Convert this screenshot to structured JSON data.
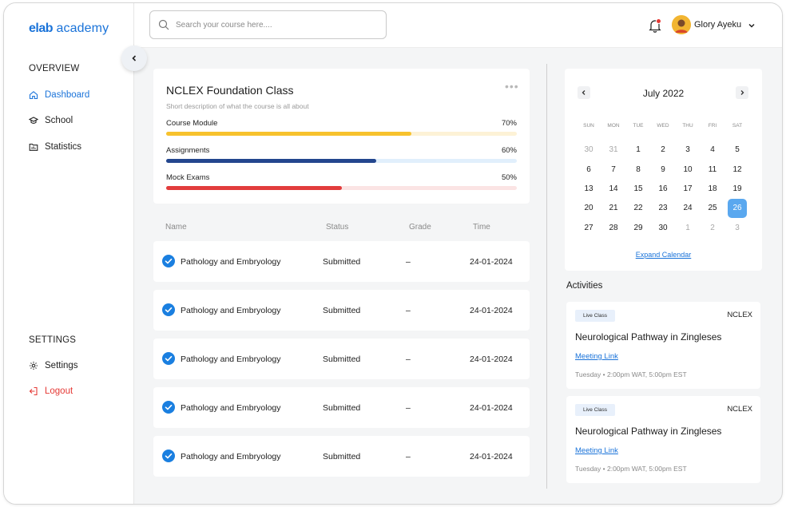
{
  "brand": {
    "logo_mark": "elab",
    "logo_text": " academy",
    "accent": "#1a73d9"
  },
  "sidebar": {
    "overview_title": "OVERVIEW",
    "items": [
      {
        "label": "Dashboard",
        "icon": "home-icon",
        "active": true
      },
      {
        "label": "School",
        "icon": "graduation-cap-icon"
      },
      {
        "label": "Statistics",
        "icon": "folder-chart-icon"
      }
    ],
    "settings_title": "SETTINGS",
    "settings_items": [
      {
        "label": "Settings",
        "icon": "gear-icon"
      },
      {
        "label": "Logout",
        "icon": "logout-icon",
        "color": "#e53935"
      }
    ]
  },
  "header": {
    "search_placeholder": "Search your course here....",
    "user_name": "Glory Ayeku",
    "notification_dot_color": "#e53935"
  },
  "course": {
    "title": "NCLEX Foundation Class",
    "description": "Short description of what the course is all about",
    "progress": [
      {
        "label": "Course Module",
        "percent_label": "70%",
        "value": 0.7,
        "color": "#f7c22d",
        "track": "#fdf2d6"
      },
      {
        "label": "Assignments",
        "percent_label": "60%",
        "value": 0.6,
        "color": "#23468e",
        "track": "#e1effc"
      },
      {
        "label": "Mock Exams",
        "percent_label": "50%",
        "value": 0.5,
        "color": "#e23c3c",
        "track": "#fbe4e4"
      }
    ]
  },
  "table": {
    "headers": {
      "name": "Name",
      "status": "Status",
      "grade": "Grade",
      "time": "Time"
    },
    "rows": [
      {
        "name": "Pathology and Embryology",
        "status": "Submitted",
        "grade": "–",
        "time": "24-01-2024"
      },
      {
        "name": "Pathology and Embryology",
        "status": "Submitted",
        "grade": "–",
        "time": "24-01-2024"
      },
      {
        "name": "Pathology and Embryology",
        "status": "Submitted",
        "grade": "–",
        "time": "24-01-2024"
      },
      {
        "name": "Pathology and Embryology",
        "status": "Submitted",
        "grade": "–",
        "time": "24-01-2024"
      },
      {
        "name": "Pathology and Embryology",
        "status": "Submitted",
        "grade": "–",
        "time": "24-01-2024"
      }
    ]
  },
  "calendar": {
    "month": "July 2022",
    "weekdays": [
      "SUN",
      "MON",
      "TUE",
      "WED",
      "THU",
      "FRI",
      "SAT"
    ],
    "weeks": [
      [
        "30",
        "31",
        "1",
        "2",
        "3",
        "4",
        "5"
      ],
      [
        "6",
        "7",
        "8",
        "9",
        "10",
        "11",
        "12"
      ],
      [
        "13",
        "14",
        "15",
        "16",
        "17",
        "18",
        "19"
      ],
      [
        "20",
        "21",
        "22",
        "23",
        "24",
        "25",
        "26"
      ],
      [
        "27",
        "28",
        "29",
        "30",
        "1",
        "2",
        "3"
      ]
    ],
    "selected_day": "26",
    "expand_label": "Expand Calendar"
  },
  "activities": {
    "title": "Activities",
    "items": [
      {
        "badge": "Live Class",
        "tag": "NCLEX",
        "title": "Neurological Pathway in Zingleses",
        "link": "Meeting Link",
        "time": "Tuesday • 2:00pm WAT, 5:00pm EST"
      },
      {
        "badge": "Live Class",
        "tag": "NCLEX",
        "title": "Neurological Pathway in Zingleses",
        "link": "Meeting Link",
        "time": "Tuesday • 2:00pm WAT, 5:00pm EST"
      }
    ]
  }
}
